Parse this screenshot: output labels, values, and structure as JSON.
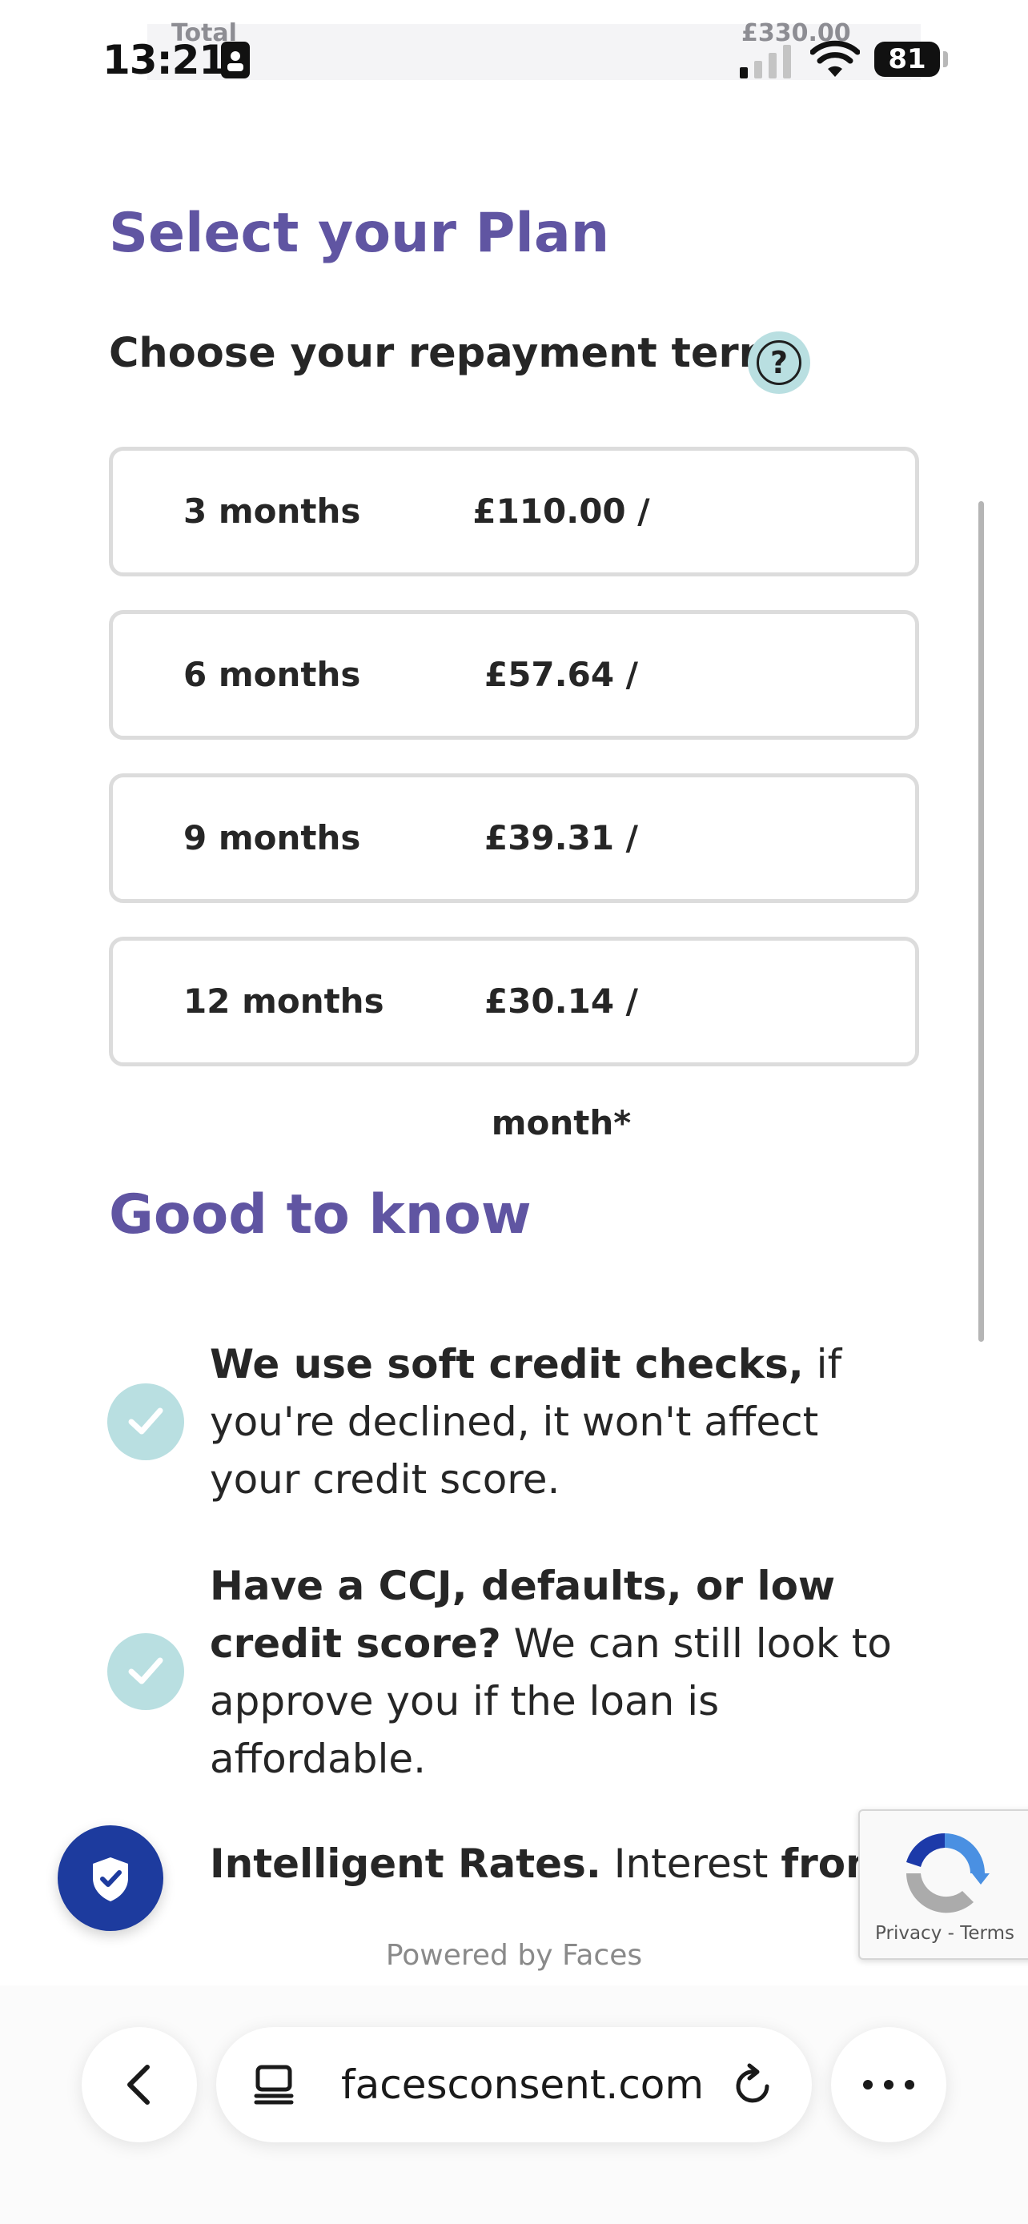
{
  "status_bar": {
    "time": "13:21",
    "battery": "81",
    "peek_left": "Total",
    "peek_right": "£330.00"
  },
  "plan": {
    "title": "Select your Plan",
    "subtitle": "Choose your repayment term",
    "help_label": "?",
    "options": [
      {
        "term": "3 months",
        "price": "£110.00 / month*"
      },
      {
        "term": "6 months",
        "price": "£57.64 / month*"
      },
      {
        "term": "9 months",
        "price": "£39.31 / month*"
      },
      {
        "term": "12 months",
        "price": "£30.14 / month*"
      }
    ]
  },
  "good_to_know": {
    "title": "Good to know",
    "items": [
      {
        "bold": "We use soft credit checks,",
        "text": " if you're declined, it won't affect your credit score."
      },
      {
        "bold": "Have a CCJ, defaults, or low credit score?",
        "text": " We can still look to approve you if the loan is affordable."
      },
      {
        "bold": "Intelligent Rates.",
        "text": " Interest ",
        "bold2": "from"
      }
    ]
  },
  "recaptcha": {
    "links": "Privacy - Terms"
  },
  "footer": {
    "powered_by": "Powered by Faces"
  },
  "browser": {
    "url": "facesconsent.com"
  },
  "colors": {
    "accent": "#6055a2",
    "check_bg": "#b9dfe1",
    "shield": "#1d3b9e"
  }
}
